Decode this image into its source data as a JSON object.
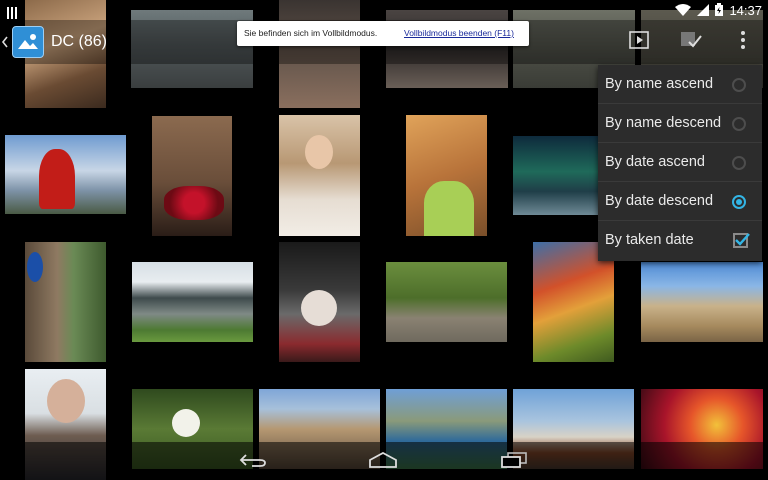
{
  "status_bar": {
    "time": "14:37"
  },
  "action_bar": {
    "title": "DC (86)"
  },
  "fullscreen_notice": {
    "message": "Sie befinden sich im Vollbildmodus.",
    "exit_link": "Vollbildmodus beenden (F11)"
  },
  "sort_menu": {
    "items": [
      {
        "label": "By name ascend",
        "control": "radio",
        "checked": false
      },
      {
        "label": "By name descend",
        "control": "radio",
        "checked": false
      },
      {
        "label": "By date ascend",
        "control": "radio",
        "checked": false
      },
      {
        "label": "By date descend",
        "control": "radio",
        "checked": true
      },
      {
        "label": "By taken date",
        "control": "checkbox",
        "checked": true
      }
    ]
  },
  "colors": {
    "accent": "#33b5e5",
    "menu_bg": "#2c2c2c",
    "app_icon": "#2f8fd6"
  },
  "icons": [
    "wifi-icon",
    "signal-icon",
    "battery-icon",
    "slideshow-icon",
    "select-icon",
    "overflow-icon",
    "back-icon",
    "home-icon",
    "recents-icon"
  ]
}
